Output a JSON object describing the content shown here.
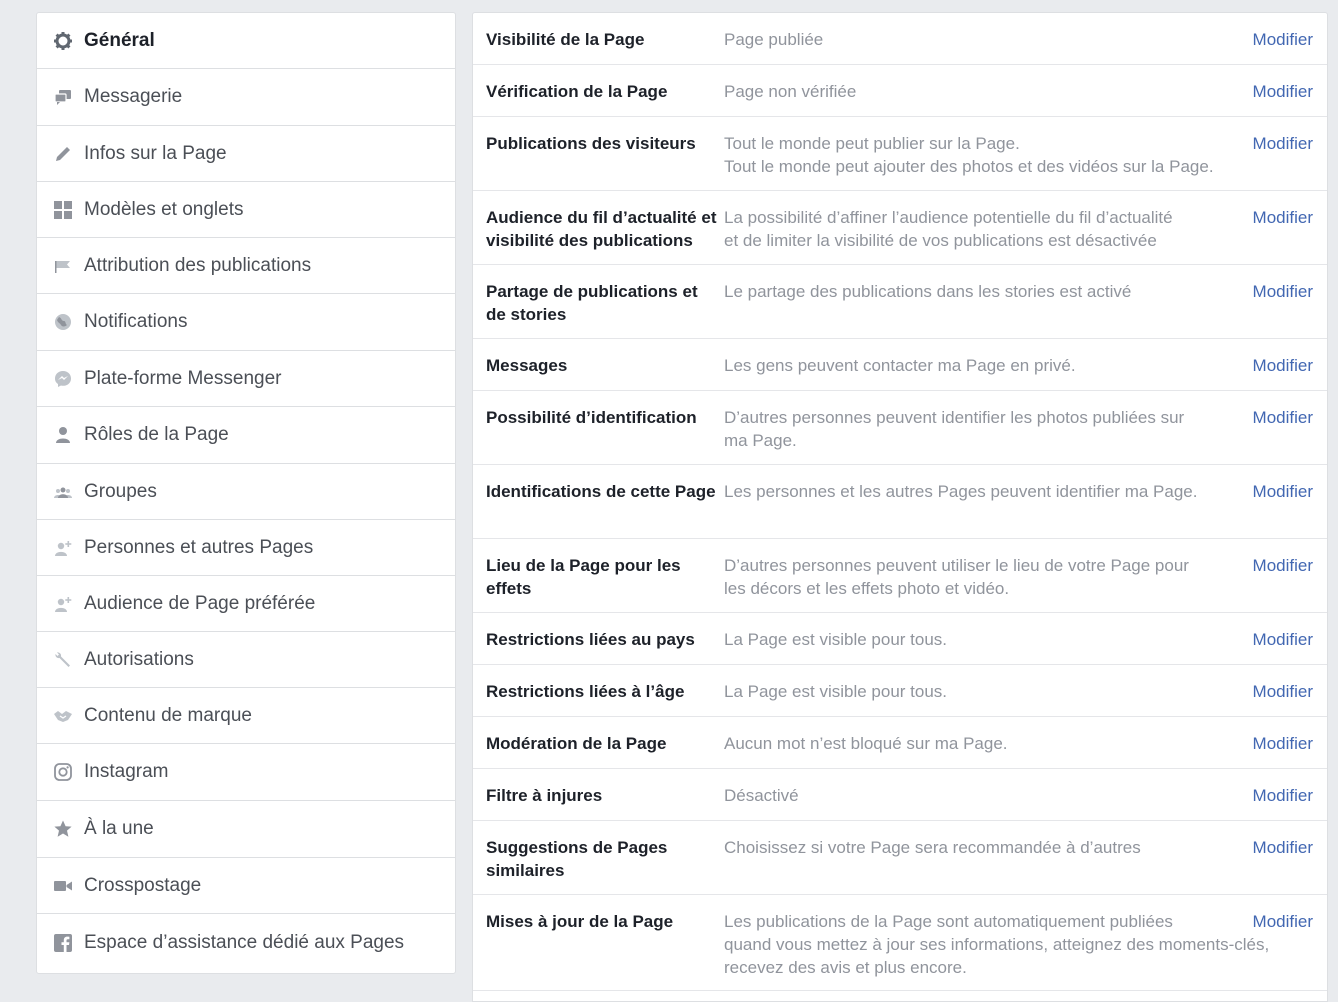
{
  "sidebar": {
    "items": [
      {
        "label": "Général",
        "icon": "gear-icon",
        "active": true
      },
      {
        "label": "Messagerie",
        "icon": "messages-icon"
      },
      {
        "label": "Infos sur la Page",
        "icon": "pencil-icon"
      },
      {
        "label": "Modèles et onglets",
        "icon": "grid-icon"
      },
      {
        "label": "Attribution des publications",
        "icon": "flag-icon"
      },
      {
        "label": "Notifications",
        "icon": "globe-icon"
      },
      {
        "label": "Plate-forme Messenger",
        "icon": "messenger-icon"
      },
      {
        "label": "Rôles de la Page",
        "icon": "person-icon"
      },
      {
        "label": "Groupes",
        "icon": "group-icon"
      },
      {
        "label": "Personnes et autres Pages",
        "icon": "person-add-icon"
      },
      {
        "label": "Audience de Page préférée",
        "icon": "person-add-icon"
      },
      {
        "label": "Autorisations",
        "icon": "wrench-icon"
      },
      {
        "label": "Contenu de marque",
        "icon": "handshake-icon"
      },
      {
        "label": "Instagram",
        "icon": "instagram-icon"
      },
      {
        "label": "À la une",
        "icon": "star-icon"
      },
      {
        "label": "Crosspostage",
        "icon": "video-camera-icon"
      },
      {
        "label": "Espace d’assistance dédié aux Pages",
        "icon": "facebook-icon"
      }
    ]
  },
  "settings": {
    "action_label": "Modifier",
    "rows": [
      {
        "label": "Visibilité de la Page",
        "value": [
          "Page publiée"
        ]
      },
      {
        "label": "Vérification de la Page",
        "value": [
          "Page non vérifiée"
        ]
      },
      {
        "label": "Publications des visiteurs",
        "value": [
          "Tout le monde peut publier sur la Page.",
          "Tout le monde peut ajouter des photos et des vidéos sur la Page."
        ]
      },
      {
        "label": "Audience du fil d’actualité et visibilité des publications",
        "value": [
          "La possibilité d’affiner l’audience potentielle du fil d’actualité",
          "et de limiter la visibilité de vos publications est désactivée"
        ]
      },
      {
        "label": "Partage de publications et de stories",
        "value": [
          "Le partage des publications dans les stories est activé"
        ]
      },
      {
        "label": "Messages",
        "value": [
          "Les gens peuvent contacter ma Page en privé."
        ]
      },
      {
        "label": "Possibilité d’identification",
        "value": [
          "D’autres personnes peuvent identifier les photos publiées sur",
          "ma Page."
        ]
      },
      {
        "label": "Identifications de cette Page",
        "value": [
          "Les personnes et les autres Pages peuvent identifier ma Page."
        ]
      },
      {
        "label": "Lieu de la Page pour les effets",
        "value": [
          "D’autres personnes peuvent utiliser le lieu de votre Page pour",
          "les décors et les effets photo et vidéo."
        ]
      },
      {
        "label": "Restrictions liées au pays",
        "value": [
          "La Page est visible pour tous."
        ]
      },
      {
        "label": "Restrictions liées à l’âge",
        "value": [
          "La Page est visible pour tous."
        ]
      },
      {
        "label": "Modération de la Page",
        "value": [
          "Aucun mot n’est bloqué sur ma Page."
        ]
      },
      {
        "label": "Filtre à injures",
        "value": [
          "Désactivé"
        ]
      },
      {
        "label": "Suggestions de Pages similaires",
        "value": [
          "Choisissez si votre Page sera recommandée à d’autres"
        ]
      },
      {
        "label": "Mises à jour de la Page",
        "value": [
          "Les publications de la Page sont automatiquement publiées",
          "quand vous mettez à jour ses informations, atteignez des moments-clés,",
          "recevez des avis et plus encore."
        ]
      }
    ]
  }
}
